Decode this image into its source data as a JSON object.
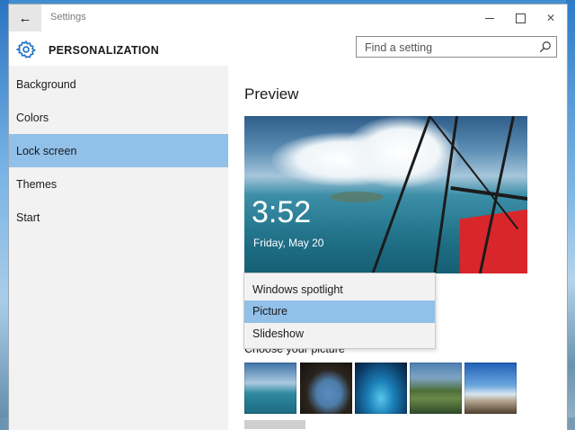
{
  "window": {
    "title": "Settings"
  },
  "header": {
    "title": "PERSONALIZATION"
  },
  "search": {
    "placeholder": "Find a setting"
  },
  "sidebar": {
    "items": [
      {
        "label": "Background"
      },
      {
        "label": "Colors"
      },
      {
        "label": "Lock screen"
      },
      {
        "label": "Themes"
      },
      {
        "label": "Start"
      }
    ],
    "active": "Lock screen"
  },
  "main": {
    "preview_title": "Preview",
    "lock_preview": {
      "time": "3:52",
      "date": "Friday, May 20"
    },
    "background_dropdown": {
      "options": [
        {
          "label": "Windows spotlight"
        },
        {
          "label": "Picture"
        },
        {
          "label": "Slideshow"
        }
      ],
      "selected": "Picture"
    },
    "choose_picture_label": "Choose your picture",
    "thumbnails": [
      "aerial-wing-photo",
      "cave-beach-photo",
      "underwater-photo",
      "mountain-lake-photo",
      "coast-cliff-photo"
    ]
  },
  "colors": {
    "accent": "#91c0e8",
    "sidebar_bg": "#f2f2f2",
    "gear": "#1e73c4"
  }
}
